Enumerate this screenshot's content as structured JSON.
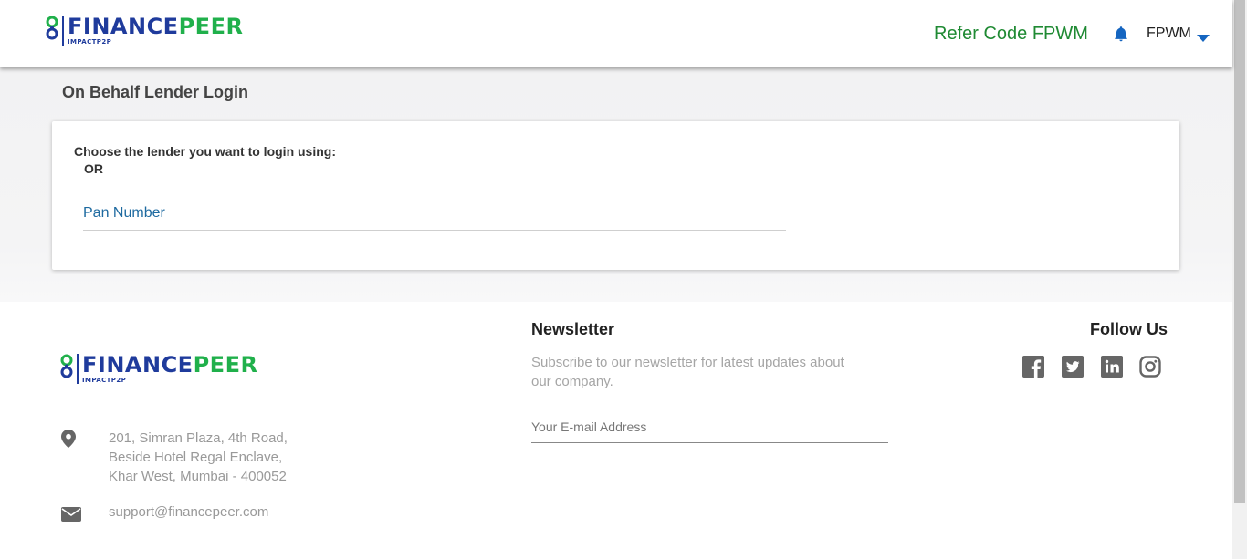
{
  "brand": {
    "name_part1": "FINANCE",
    "name_part2": "PEER",
    "tagline": "IMPACTP2P"
  },
  "header": {
    "refer_label": "Refer Code FPWM",
    "user_label": "FPWM"
  },
  "main": {
    "title": "On Behalf Lender Login",
    "choose_label": "Choose the lender you want to login using:",
    "or_label": "OR",
    "pan_placeholder": "Pan Number"
  },
  "footer": {
    "address_lines": [
      "201, Simran Plaza, 4th Road,",
      "Beside Hotel Regal Enclave,",
      "Khar West, Mumbai - 400052"
    ],
    "email": "support@financepeer.com",
    "newsletter_title": "Newsletter",
    "newsletter_desc": "Subscribe to our newsletter for latest updates about our company.",
    "newsletter_placeholder": "Your E-mail Address",
    "follow_title": "Follow Us",
    "social": [
      "facebook-icon",
      "twitter-icon",
      "linkedin-icon",
      "instagram-icon"
    ]
  },
  "colors": {
    "brand_blue": "#1f3b9c",
    "brand_green": "#20b04b",
    "refer_green": "#1f8a33",
    "accent_blue": "#1e6aa0",
    "bell_blue": "#1565c0"
  }
}
